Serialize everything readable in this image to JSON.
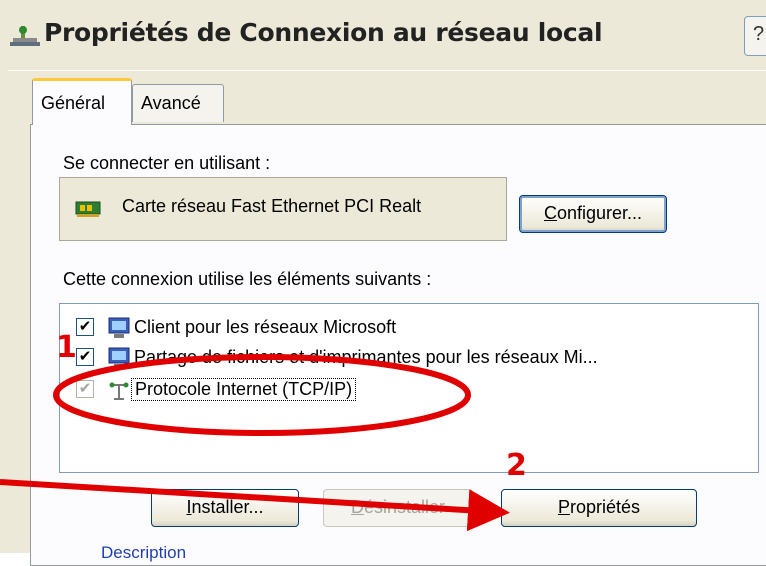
{
  "window": {
    "title": "Propriétés de Connexion au réseau local",
    "titlebar_button_glyph": "?"
  },
  "tabs": [
    {
      "label": "Général",
      "active": true
    },
    {
      "label": "Avancé",
      "active": false
    }
  ],
  "connect_section": {
    "label": "Se connecter en utilisant :",
    "adapter_name": "Carte réseau Fast Ethernet PCI Realt",
    "adapter_icon": "network-card-icon",
    "configure_button": "Configurer..."
  },
  "components_section": {
    "label": "Cette connexion utilise les éléments suivants :",
    "items": [
      {
        "label": "Client pour les réseaux Microsoft",
        "checked": true,
        "icon": "network-client-icon"
      },
      {
        "label": "Partage de fichiers et d'imprimantes pour les réseaux Mi...",
        "checked": true,
        "icon": "file-printer-sharing-icon"
      },
      {
        "label": "Protocole Internet (TCP/IP)",
        "checked": true,
        "icon": "protocol-icon",
        "selected": true
      }
    ]
  },
  "buttons": {
    "install": "Installer...",
    "uninstall": "Désinstaller",
    "properties": "Propriétés"
  },
  "description_partial": "Description",
  "annotations": {
    "step1": "1",
    "step2": "2",
    "color": "#e00000"
  }
}
